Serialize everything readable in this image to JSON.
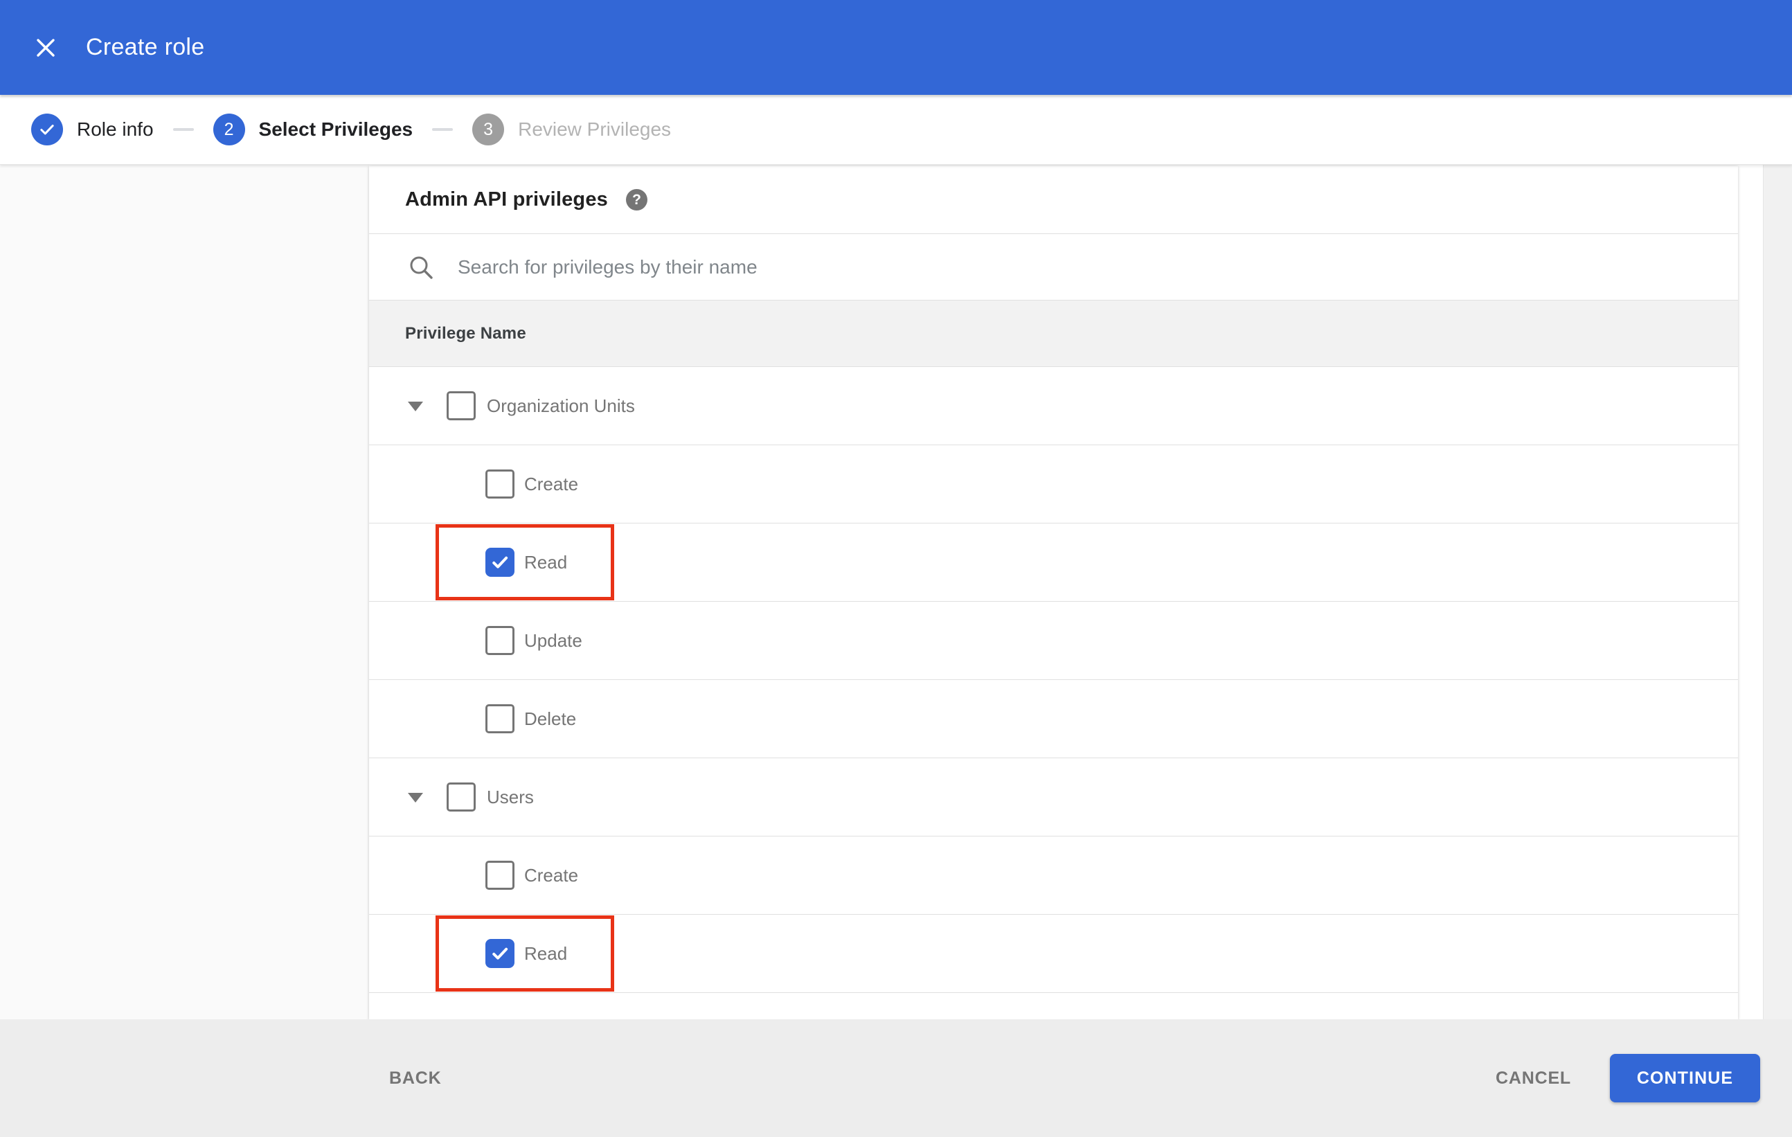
{
  "ui_colors": {
    "accent_blue": "#3367d6",
    "highlight_red": "#e83317",
    "footer_gray": "#ededed",
    "header_band_gray": "#f2f2f2"
  },
  "app_bar": {
    "title": "Create role",
    "close_icon": "x-close"
  },
  "stepper": {
    "steps": [
      {
        "label": "Role info",
        "state": "done",
        "icon": "checkmark"
      },
      {
        "label": "Select Privileges",
        "state": "active",
        "number": "2"
      },
      {
        "label": "Review Privileges",
        "state": "upcoming",
        "number": "3"
      }
    ]
  },
  "panel": {
    "title": "Admin API privileges",
    "help_icon": "?",
    "search_placeholder": "Search for privileges by their name",
    "search_value": "",
    "table_header": "Privilege Name",
    "rows": [
      {
        "label": "Organization Units",
        "level": "group",
        "expanded": true,
        "checked": false,
        "highlighted": false
      },
      {
        "label": "Create",
        "level": "child",
        "checked": false,
        "highlighted": false
      },
      {
        "label": "Read",
        "level": "child",
        "checked": true,
        "highlighted": true
      },
      {
        "label": "Update",
        "level": "child",
        "checked": false,
        "highlighted": false
      },
      {
        "label": "Delete",
        "level": "child",
        "checked": false,
        "highlighted": false
      },
      {
        "label": "Users",
        "level": "group",
        "expanded": true,
        "checked": false,
        "highlighted": false
      },
      {
        "label": "Create",
        "level": "child",
        "checked": false,
        "highlighted": false
      },
      {
        "label": "Read",
        "level": "child",
        "checked": true,
        "highlighted": true
      }
    ]
  },
  "footer": {
    "back_label": "BACK",
    "cancel_label": "CANCEL",
    "continue_label": "CONTINUE"
  }
}
